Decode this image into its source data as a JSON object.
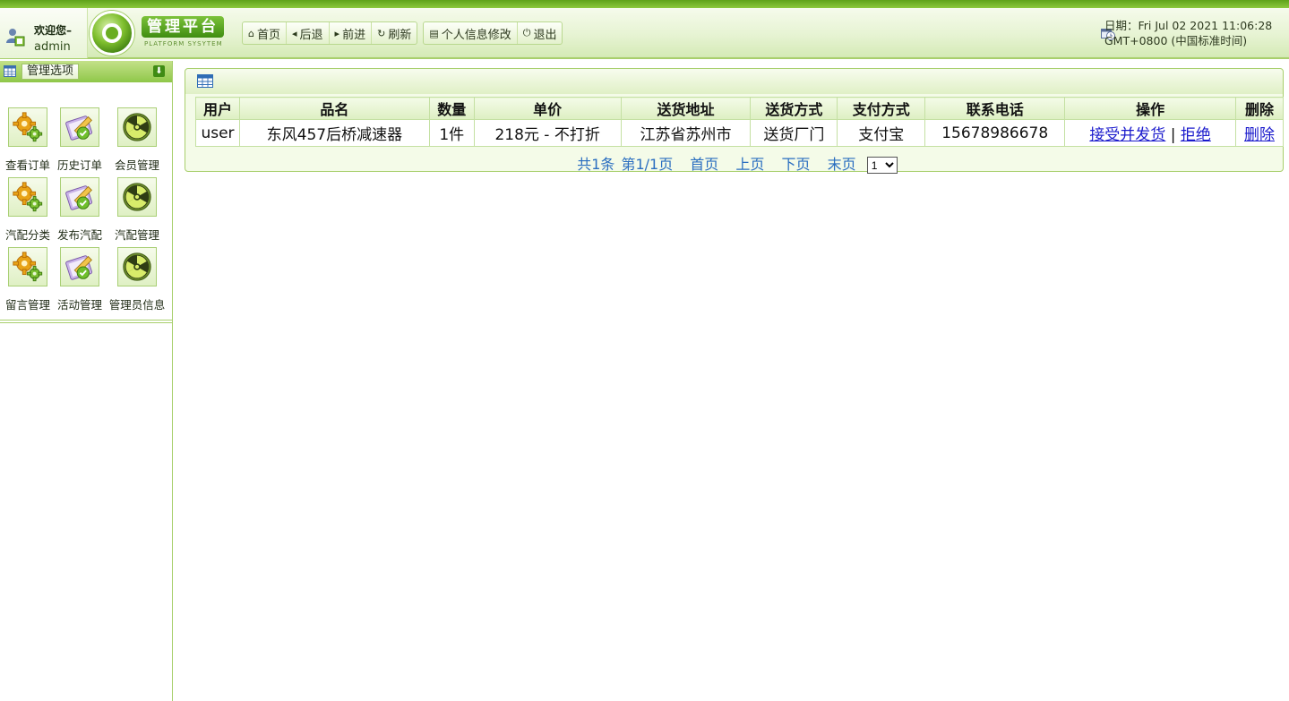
{
  "header": {
    "welcome": "欢迎您–",
    "username": "admin",
    "platform_title": "管理平台",
    "platform_subtitle": "PLATFORM SYSYTEM",
    "toolbar": {
      "home": "首页",
      "back": "后退",
      "forward": "前进",
      "refresh": "刷新",
      "profile": "个人信息修改",
      "logout": "退出"
    },
    "date_line1": "日期：Fri Jul 02 2021 11:06:28",
    "date_line2": "GMT+0800 (中国标准时间)"
  },
  "sidebar": {
    "title": "管理选项",
    "items": [
      {
        "label": "查看订单",
        "icon": "gear-icon"
      },
      {
        "label": "历史订单",
        "icon": "edit-icon"
      },
      {
        "label": "会员管理",
        "icon": "radiation-icon"
      },
      {
        "label": "汽配分类",
        "icon": "gear-icon"
      },
      {
        "label": "发布汽配",
        "icon": "edit-icon"
      },
      {
        "label": "汽配管理",
        "icon": "radiation-icon"
      },
      {
        "label": "留言管理",
        "icon": "gear-icon"
      },
      {
        "label": "活动管理",
        "icon": "edit-icon"
      },
      {
        "label": "管理员信息",
        "icon": "radiation-icon"
      }
    ]
  },
  "table": {
    "headers": [
      "用户",
      "品名",
      "数量",
      "单价",
      "送货地址",
      "送货方式",
      "支付方式",
      "联系电话",
      "操作",
      "删除"
    ],
    "rows": [
      {
        "user": "user",
        "product": "东风457后桥减速器",
        "quantity": "1件",
        "price": "218元 - 不打折",
        "address": "江苏省苏州市",
        "delivery": "送货厂门",
        "payment": "支付宝",
        "phone": "15678986678",
        "accept": "接受并发货",
        "sep": "|",
        "reject": "拒绝",
        "delete": "删除"
      }
    ]
  },
  "pager": {
    "total": "共1条",
    "page": "第1/1页",
    "first": "首页",
    "prev": "上页",
    "next": "下页",
    "last": "末页",
    "select_value": "1"
  },
  "colors": {
    "accent_green": "#5ea21a",
    "border_green": "#a8cf6c",
    "link_blue": "#1a1acc",
    "pager_blue": "#2a6ec0"
  }
}
